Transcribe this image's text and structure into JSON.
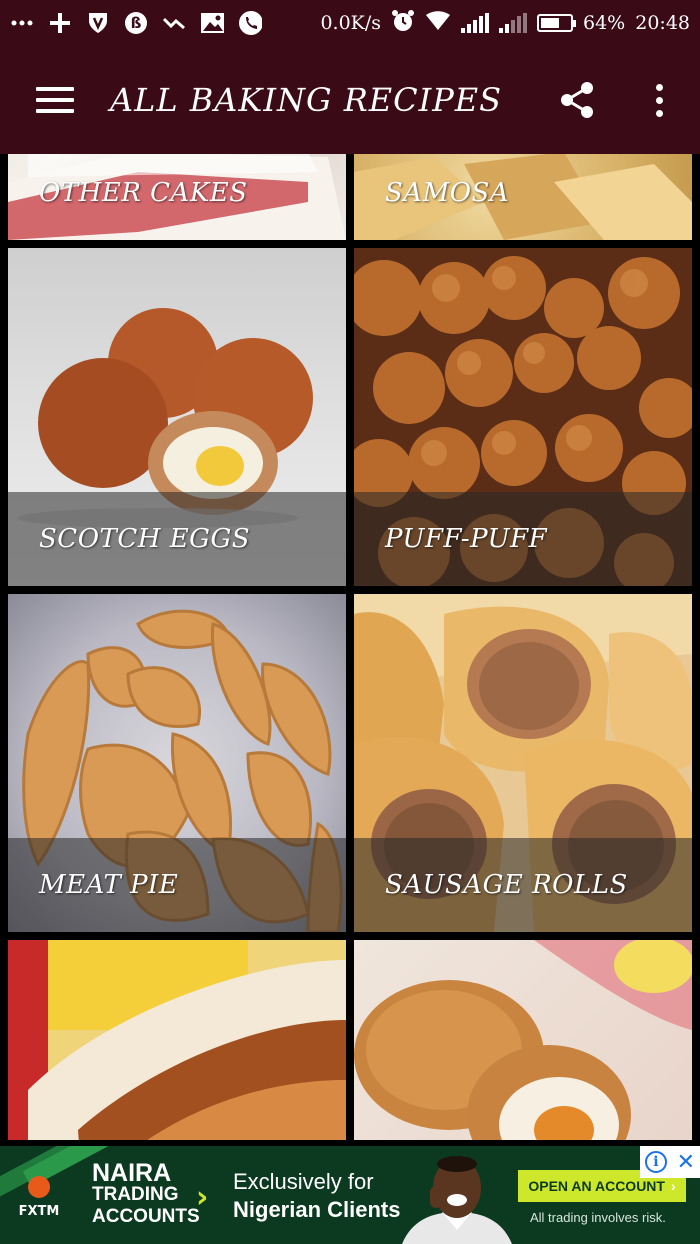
{
  "status_bar": {
    "network_speed": "0.0K/s",
    "battery_percent": "64%",
    "battery_level": 0.64,
    "time": "20:48",
    "icons": [
      "more-notifications-icon",
      "plus-icon",
      "vpn-shield-icon",
      "b-icon",
      "check-icon",
      "image-icon",
      "phone-icon",
      "alarm-icon",
      "wifi-icon",
      "signal-icon",
      "signal-icon-2",
      "battery-icon"
    ]
  },
  "app_bar": {
    "title": "ALL BAKING RECIPES",
    "background": "#3a0b17",
    "icons": [
      "hamburger-menu-icon",
      "share-icon",
      "more-vert-icon"
    ]
  },
  "recipes": [
    {
      "label": "OTHER CAKES"
    },
    {
      "label": "SAMOSA"
    },
    {
      "label": "SCOTCH EGGS"
    },
    {
      "label": "PUFF-PUFF"
    },
    {
      "label": "MEAT PIE"
    },
    {
      "label": "SAUSAGE ROLLS"
    },
    {
      "label": ""
    },
    {
      "label": ""
    }
  ],
  "ad": {
    "brand": "FXTM",
    "headline_1": "NAIRA",
    "headline_2": "TRADING",
    "headline_3": "ACCOUNTS",
    "tagline_1": "Exclusively for",
    "tagline_2": "Nigerian Clients",
    "cta": "OPEN AN ACCOUNT",
    "disclaimer": "All trading involves risk.",
    "accent": "#cde82a",
    "background": "#0c3a20"
  }
}
